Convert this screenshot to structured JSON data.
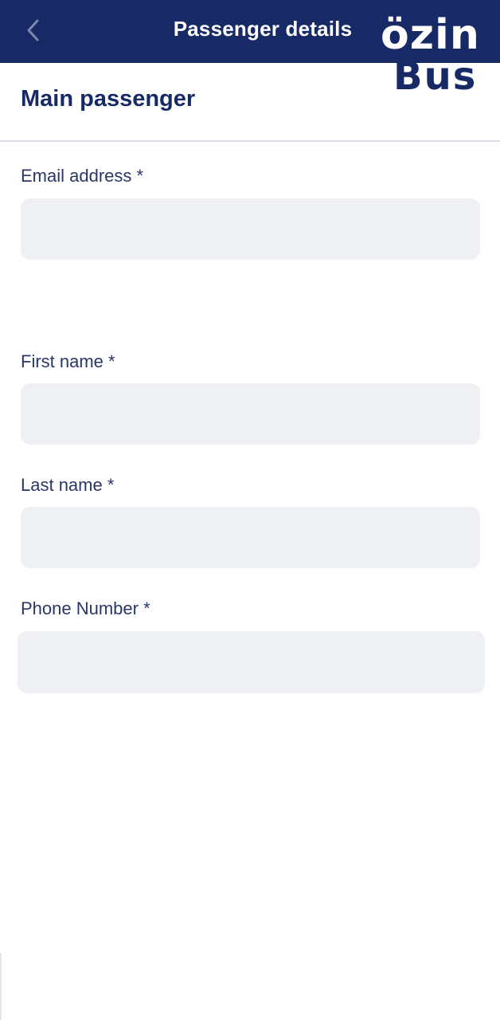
{
  "header": {
    "title": "Passenger details",
    "back_icon": "chevron-left-icon"
  },
  "logo": {
    "line1": "özin",
    "line2": "Bus"
  },
  "section": {
    "title": "Main passenger"
  },
  "form": {
    "email": {
      "label": "Email address *",
      "value": "",
      "placeholder": ""
    },
    "first_name": {
      "label": "First name *",
      "value": "",
      "placeholder": ""
    },
    "last_name": {
      "label": "Last name *",
      "value": "",
      "placeholder": ""
    },
    "phone": {
      "label": "Phone Number *",
      "value": "",
      "placeholder": ""
    }
  },
  "colors": {
    "primary": "#172a66",
    "input_bg": "#eff0f4",
    "label": "#2a3766"
  }
}
